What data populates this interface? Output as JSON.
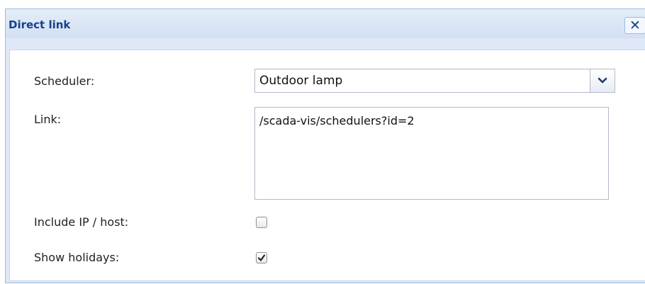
{
  "dialog": {
    "title": "Direct link",
    "close_glyph": "✕"
  },
  "form": {
    "scheduler_label": "Scheduler:",
    "scheduler_value": "Outdoor lamp",
    "link_label": "Link:",
    "link_value": "/scada-vis/schedulers?id=2",
    "include_ip_label": "Include IP / host:",
    "include_ip_checked": false,
    "show_holidays_label": "Show holidays:",
    "show_holidays_checked": true
  },
  "colors": {
    "title_text": "#15428b",
    "border_accent": "#99bbe8"
  },
  "icons": {
    "close": "close-icon",
    "dropdown": "chevron-down-icon",
    "check": "checkmark-icon"
  }
}
